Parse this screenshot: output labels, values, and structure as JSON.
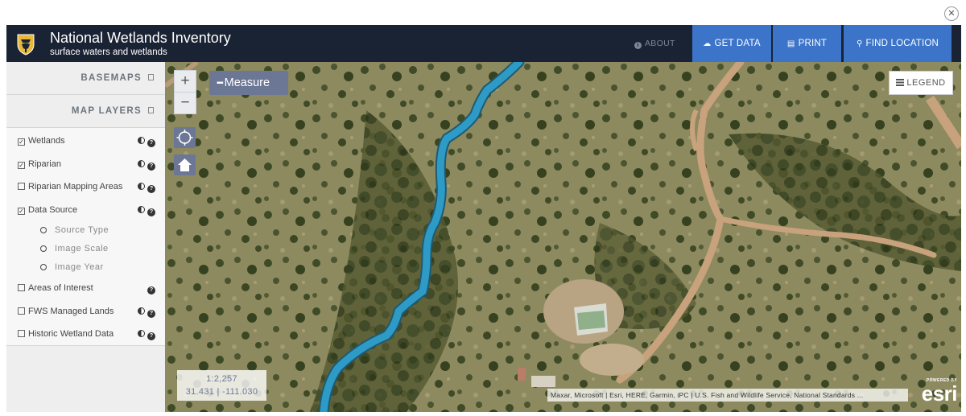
{
  "dialog": {
    "close_icon": "close-icon"
  },
  "header": {
    "title": "National Wetlands Inventory",
    "subtitle": "surface waters and wetlands",
    "logo_icon": "fws-shield-icon",
    "about_label": "ABOUT",
    "get_data_label": "GET DATA",
    "print_label": "PRINT",
    "find_location_label": "FIND LOCATION",
    "accent_color": "#3b74c9",
    "bar_color": "#1a2333"
  },
  "sidebar": {
    "basemaps_label": "BASEMAPS",
    "map_layers_label": "MAP LAYERS",
    "layers": [
      {
        "label": "Wetlands",
        "checked": true,
        "opacity": true,
        "help": true
      },
      {
        "label": "Riparian",
        "checked": true,
        "opacity": true,
        "help": true
      },
      {
        "label": "Riparian Mapping Areas",
        "checked": false,
        "opacity": true,
        "help": true
      },
      {
        "label": "Data Source",
        "checked": true,
        "opacity": true,
        "help": true
      },
      {
        "label": "Areas of Interest",
        "checked": false,
        "opacity": false,
        "help": true
      },
      {
        "label": "FWS Managed Lands",
        "checked": false,
        "opacity": true,
        "help": true
      },
      {
        "label": "Historic Wetland Data",
        "checked": false,
        "opacity": true,
        "help": true
      }
    ],
    "data_source_options": [
      "Source Type",
      "Image Scale",
      "Image Year"
    ]
  },
  "map": {
    "zoom_in": "+",
    "zoom_out": "−",
    "measure_label": "Measure",
    "legend_label": "LEGEND",
    "scale": "1:2,257",
    "coordinates": "31.431 | -111.030",
    "attribution": "Maxar, Microsoft | Esri, HERE, Garmin, iPC | U.S. Fish and Wildlife Service, National Standards ...",
    "powered_by": "POWERED BY",
    "esri_logo": "esri",
    "wetland_color": "#2e9bc7"
  }
}
